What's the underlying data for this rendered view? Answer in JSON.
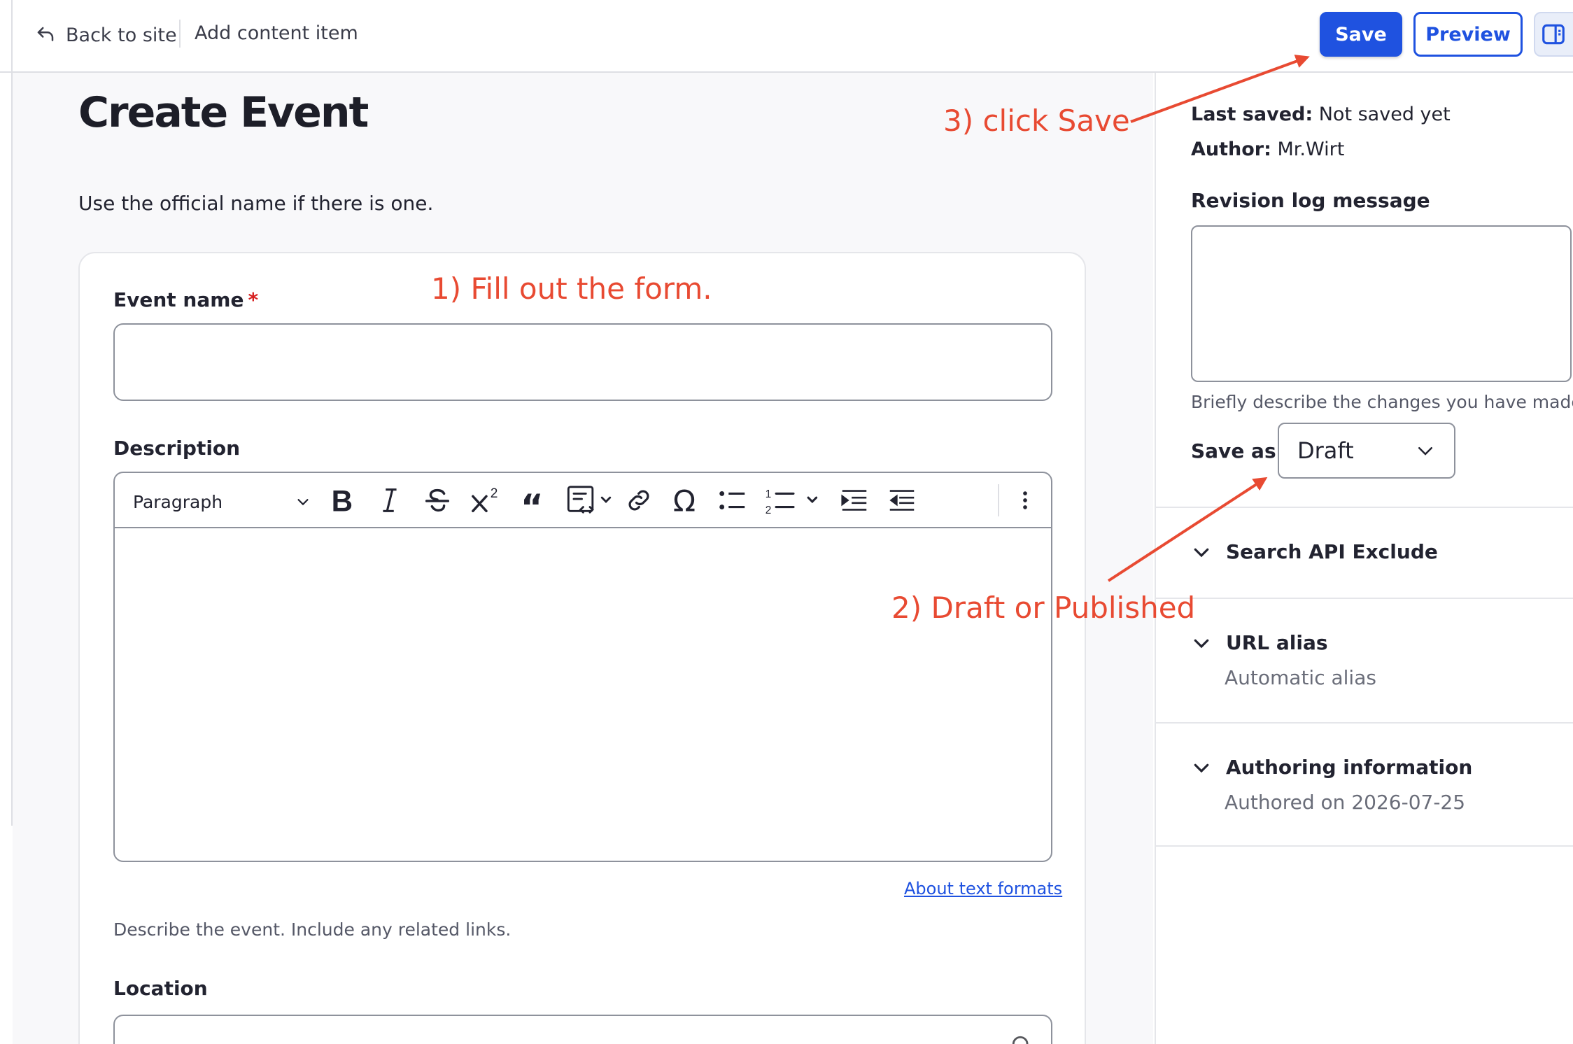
{
  "topbar": {
    "back_label": "Back to site",
    "title": "Add content item",
    "save_label": "Save",
    "preview_label": "Preview"
  },
  "main": {
    "page_title": "Create Event",
    "intro": "Use the official name if there is one.",
    "event_name_label": "Event name",
    "required_mark": "*",
    "event_name_value": "",
    "description_label": "Description",
    "format_select": "Paragraph",
    "about_formats_link": "About text formats",
    "description_help": "Describe the event. Include any related links.",
    "location_label": "Location",
    "location_value": "",
    "toolbar_icons": [
      "bold-icon",
      "italic-icon",
      "strikethrough-icon",
      "superscript-icon",
      "blockquote-icon",
      "code-block-icon",
      "link-icon",
      "special-characters-icon",
      "bulleted-list-icon",
      "numbered-list-icon",
      "outdent-icon",
      "indent-icon",
      "more-icon"
    ]
  },
  "sidebar": {
    "last_saved_label": "Last saved:",
    "last_saved_value": "Not saved yet",
    "author_label": "Author:",
    "author_value": "Mr.Wirt",
    "revision_label": "Revision log message",
    "revision_value": "",
    "revision_help": "Briefly describe the changes you have made.",
    "save_as_label": "Save as:",
    "save_as_value": "Draft",
    "accordions": [
      {
        "title": "Search API Exclude",
        "subtitle": ""
      },
      {
        "title": "URL alias",
        "subtitle": "Automatic alias"
      },
      {
        "title": "Authoring information",
        "subtitle": "Authored on 2026-07-25"
      }
    ]
  },
  "annotations": {
    "step1": "1) Fill out the form.",
    "step2": "2) Draft or Published",
    "step3": "3) click Save",
    "color": "#e84a32"
  },
  "colors": {
    "accent": "#1f52e0",
    "required": "#d72222",
    "background": "#f8f8fa"
  }
}
